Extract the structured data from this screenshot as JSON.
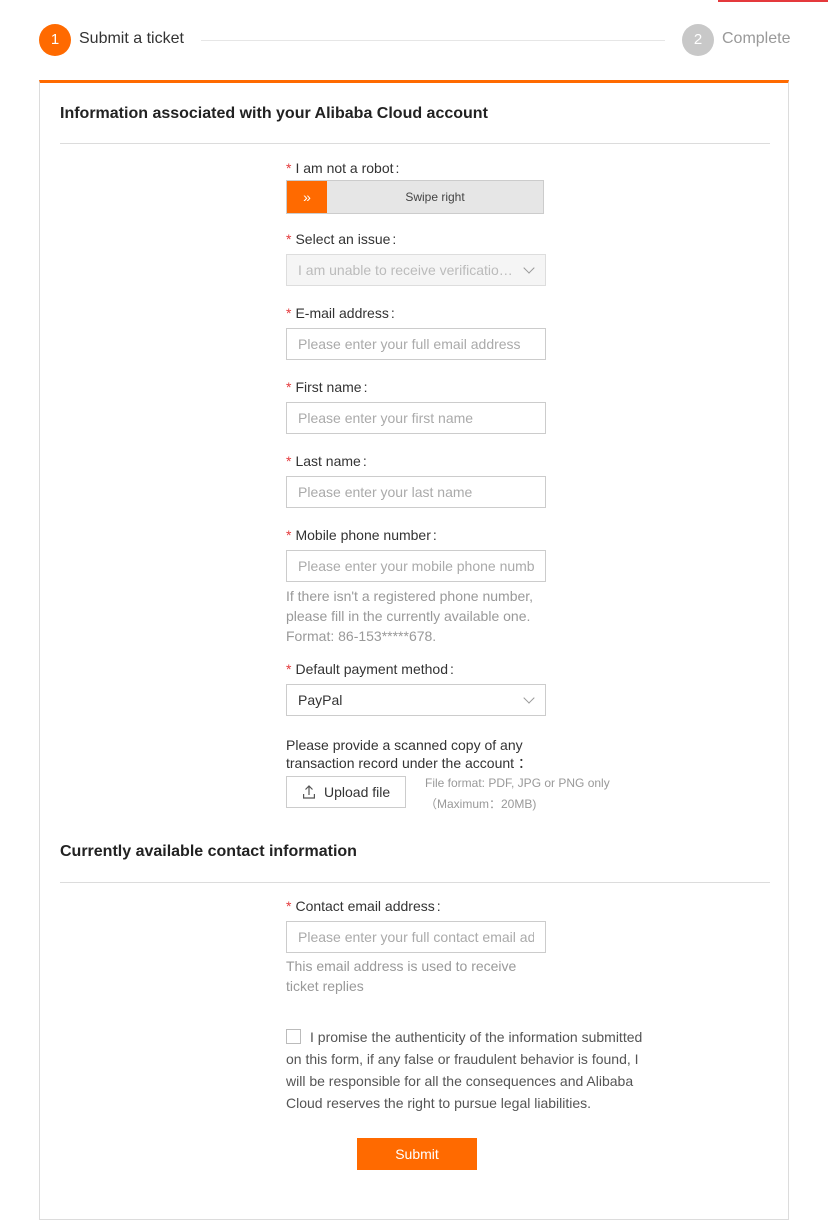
{
  "stepper": {
    "step1": {
      "number": "1",
      "label": "Submit a ticket"
    },
    "step2": {
      "number": "2",
      "label": "Complete"
    }
  },
  "colors": {
    "accent": "#ff6a00",
    "required": "#e4393c"
  },
  "section1": {
    "title": "Information associated with your Alibaba Cloud account"
  },
  "robot": {
    "label": "I am not a robot",
    "handle": "»",
    "text": "Swipe right"
  },
  "issue": {
    "label": "Select an issue",
    "value": "I am unable to receive verification codes"
  },
  "email": {
    "label": "E-mail address",
    "placeholder": "Please enter your full email address"
  },
  "first_name": {
    "label": "First name",
    "placeholder": "Please enter your first name"
  },
  "last_name": {
    "label": "Last name",
    "placeholder": "Please enter your last name"
  },
  "mobile": {
    "label": "Mobile phone number",
    "placeholder": "Please enter your mobile phone number",
    "hint": "If there isn't a registered phone number, please fill in the currently available one. Format: 86-153*****678."
  },
  "payment": {
    "label": "Default payment method",
    "value": "PayPal"
  },
  "upload": {
    "label": "Please provide a scanned copy of any transaction record under the account ：",
    "button": "Upload file",
    "format_note": "File format: PDF, JPG or PNG only",
    "size_note": "（Maximum：20MB)"
  },
  "section2": {
    "title": "Currently available contact information"
  },
  "contact_email": {
    "label": "Contact email address",
    "placeholder": "Please enter your full contact email address",
    "hint": "This email address is used to receive ticket replies"
  },
  "promise": {
    "text": "I promise the authenticity of the information submitted on this form, if any false or fraudulent behavior is found, I will be responsible for all the consequences and Alibaba Cloud reserves the right to pursue legal liabilities."
  },
  "submit": {
    "label": "Submit"
  },
  "common": {
    "required_mark": "*",
    "colon": ":"
  }
}
